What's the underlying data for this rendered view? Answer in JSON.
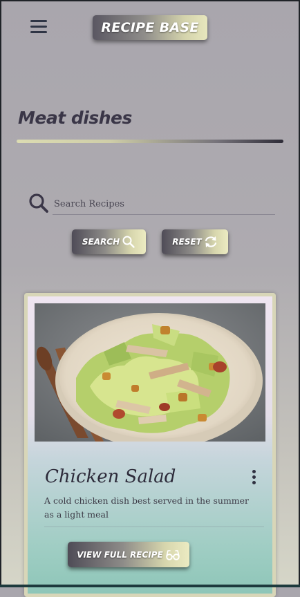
{
  "header": {
    "menu_icon": "hamburger-menu-icon",
    "brand": "RECIPE BASE"
  },
  "section": {
    "title": "Meat dishes"
  },
  "search": {
    "icon": "search-icon",
    "placeholder": "Search Recipes",
    "value": "",
    "search_button": {
      "label": "SEARCH",
      "icon": "search-icon"
    },
    "reset_button": {
      "label": "RESET",
      "icon": "refresh-icon"
    }
  },
  "recipes": [
    {
      "title": "Chicken Salad",
      "description": "A cold chicken dish best served in the summer as a light meal",
      "image": "chicken-salad-photo",
      "menu_icon": "more-vertical-icon",
      "button": {
        "label": "VIEW FULL RECIPE",
        "icon": "glasses-icon"
      }
    }
  ],
  "colors": {
    "background": "#aeabb0",
    "accent_dark": "#4f4c57",
    "accent_light": "#ecebc2",
    "title_text": "#3a3647",
    "card_teal": "#8ec6b8"
  }
}
